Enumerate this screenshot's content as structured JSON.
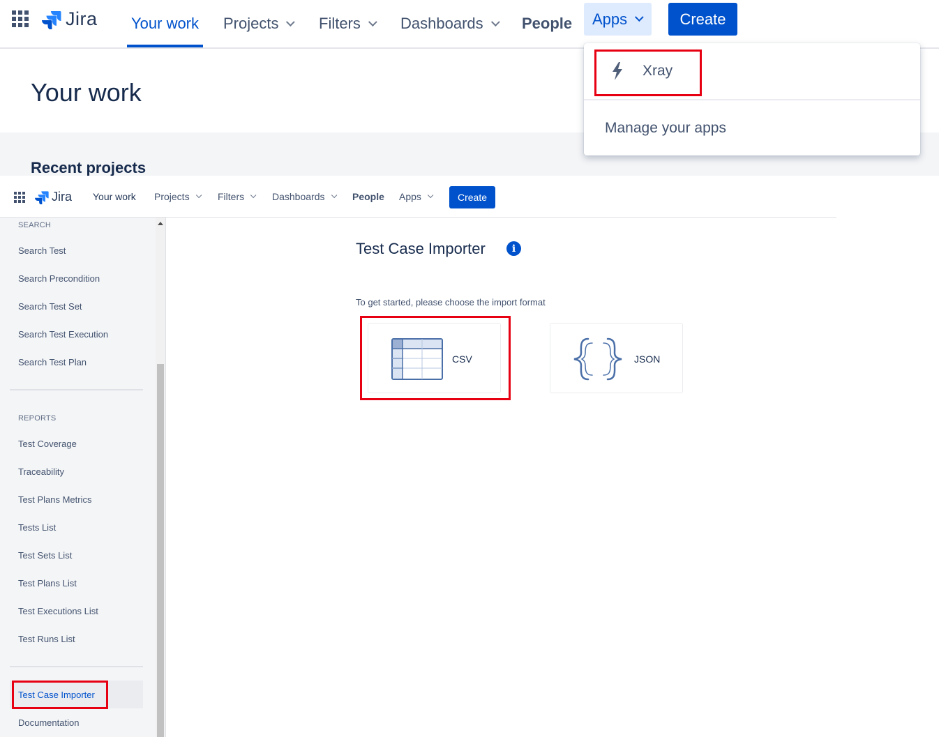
{
  "top": {
    "logo_text": "Jira",
    "nav": {
      "your_work": "Your work",
      "projects": "Projects",
      "filters": "Filters",
      "dashboards": "Dashboards",
      "people": "People",
      "apps": "Apps"
    },
    "create_label": "Create",
    "page_title": "Your work",
    "recent_projects": "Recent projects"
  },
  "apps_dropdown": {
    "xray_label": "Xray",
    "manage_label": "Manage your apps"
  },
  "sub": {
    "logo_text": "Jira",
    "nav": {
      "your_work": "Your work",
      "projects": "Projects",
      "filters": "Filters",
      "dashboards": "Dashboards",
      "people": "People",
      "apps": "Apps"
    },
    "create_label": "Create"
  },
  "sidebar": {
    "search_heading": "SEARCH",
    "search_items": [
      "Search Test",
      "Search Precondition",
      "Search Test Set",
      "Search Test Execution",
      "Search Test Plan"
    ],
    "reports_heading": "REPORTS",
    "report_items": [
      "Test Coverage",
      "Traceability",
      "Test Plans Metrics",
      "Tests List",
      "Test Sets List",
      "Test Plans List",
      "Test Executions List",
      "Test Runs List"
    ],
    "importer": "Test Case Importer",
    "documentation": "Documentation"
  },
  "main": {
    "title": "Test Case Importer",
    "info_glyph": "i",
    "subtitle": "To get started, please choose the import format",
    "formats": [
      "CSV",
      "JSON"
    ]
  },
  "colors": {
    "brand_blue": "#0052cc",
    "highlight_red": "#e60012",
    "sidebar_bg": "#f4f5f7"
  }
}
